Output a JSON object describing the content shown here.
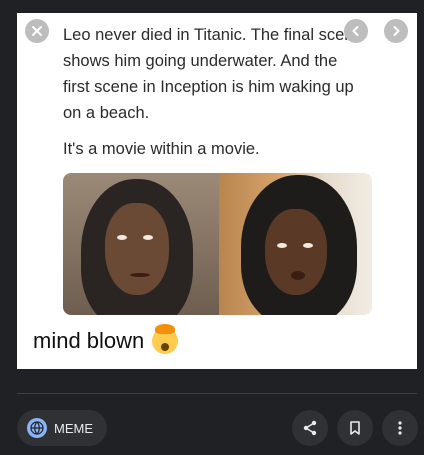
{
  "meme": {
    "line1": "Leo never died in Titanic. The final scene shows him going underwater. And the first scene in Inception is him waking up on a beach.",
    "line2": "It's a movie within a movie.",
    "caption": "mind blown"
  },
  "source_chip": {
    "label": "MEME",
    "icon": "globe-icon"
  },
  "colors": {
    "background": "#202124",
    "button": "#303134",
    "accent": "#8ab4f8"
  }
}
